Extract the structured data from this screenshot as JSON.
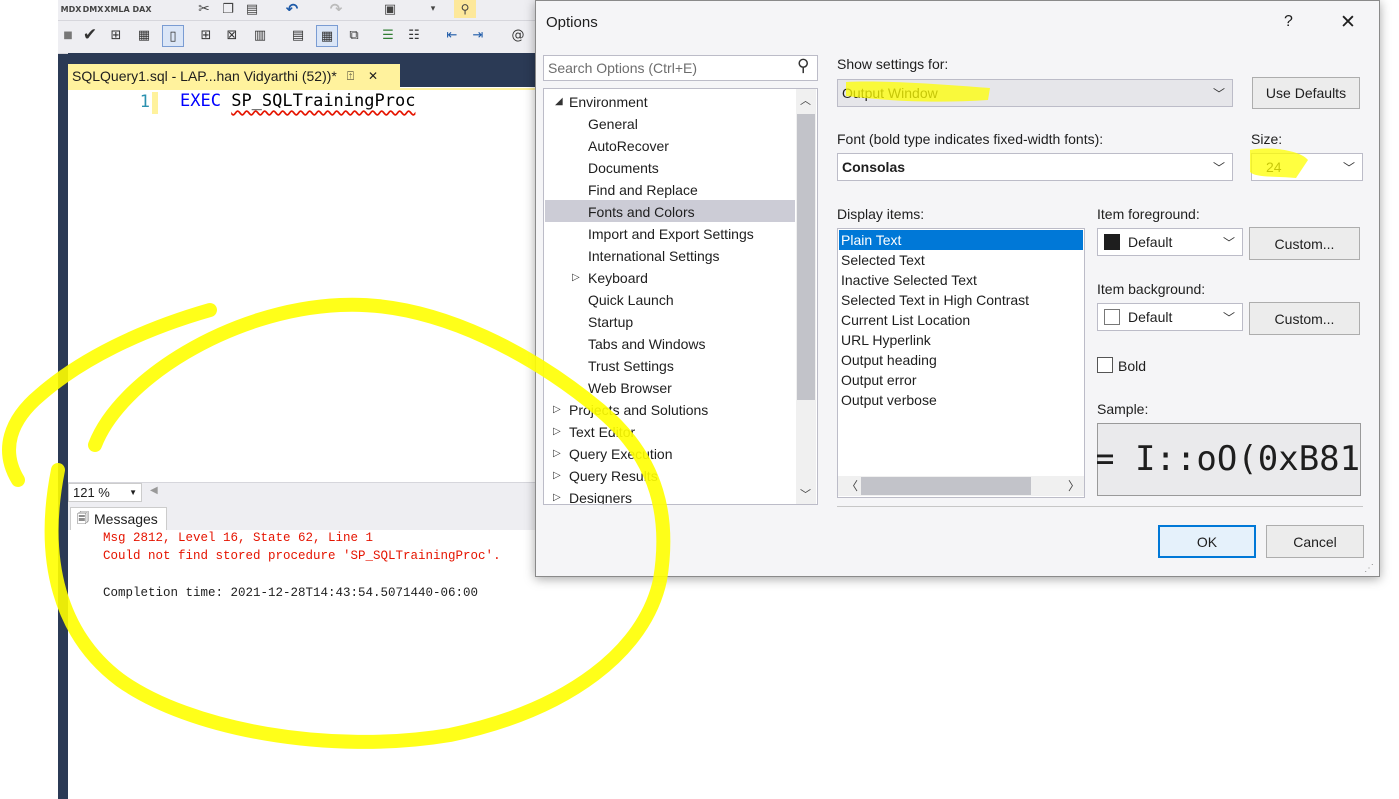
{
  "editor": {
    "tab_title": "SQLQuery1.sql - LAP...han Vidyarthi (52))*",
    "tab_pin": "⍐",
    "tab_close": "✕",
    "line_number": "1",
    "code_keyword": "EXEC",
    "code_identifier": "SP_SQLTrainingProc",
    "zoom": "121 %"
  },
  "results": {
    "tab_label": "Messages",
    "lines": [
      "Msg 2812, Level 16, State 62, Line 1",
      "Could not find stored procedure 'SP_SQLTrainingProc'.",
      "Completion time: 2021-12-28T14:43:54.5071440-06:00"
    ]
  },
  "dialog": {
    "title": "Options",
    "help": "?",
    "close": "✕",
    "search_placeholder": "Search Options (Ctrl+E)",
    "tree": [
      {
        "label": "Environment",
        "level": 0,
        "expanded": true
      },
      {
        "label": "General",
        "level": 1
      },
      {
        "label": "AutoRecover",
        "level": 1
      },
      {
        "label": "Documents",
        "level": 1
      },
      {
        "label": "Find and Replace",
        "level": 1
      },
      {
        "label": "Fonts and Colors",
        "level": 1,
        "selected": true
      },
      {
        "label": "Import and Export Settings",
        "level": 1
      },
      {
        "label": "International Settings",
        "level": 1
      },
      {
        "label": "Keyboard",
        "level": 1,
        "collapsed": true
      },
      {
        "label": "Quick Launch",
        "level": 1
      },
      {
        "label": "Startup",
        "level": 1
      },
      {
        "label": "Tabs and Windows",
        "level": 1
      },
      {
        "label": "Trust Settings",
        "level": 1
      },
      {
        "label": "Web Browser",
        "level": 1
      },
      {
        "label": "Projects and Solutions",
        "level": 0,
        "collapsed": true
      },
      {
        "label": "Text Editor",
        "level": 0,
        "collapsed": true
      },
      {
        "label": "Query Execution",
        "level": 0,
        "collapsed": true
      },
      {
        "label": "Query Results",
        "level": 0,
        "collapsed": true
      },
      {
        "label": "Designers",
        "level": 0,
        "collapsed": true
      }
    ],
    "show_settings_label": "Show settings for:",
    "show_settings_value": "Output Window",
    "use_defaults": "Use Defaults",
    "font_label": "Font (bold type indicates fixed-width fonts):",
    "font_value": "Consolas",
    "size_label": "Size:",
    "size_value": "24",
    "display_items_label": "Display items:",
    "display_items": [
      "Plain Text",
      "Selected Text",
      "Inactive Selected Text",
      "Selected Text in High Contrast",
      "Current List Location",
      "URL Hyperlink",
      "Output heading",
      "Output error",
      "Output verbose"
    ],
    "selected_display_item": "Plain Text",
    "item_foreground_label": "Item foreground:",
    "item_foreground_value": "Default",
    "item_background_label": "Item background:",
    "item_background_value": "Default",
    "custom_label": "Custom...",
    "bold_label": "Bold",
    "sample_label": "Sample:",
    "sample_text": "= I::oO(0xB81",
    "ok": "OK",
    "cancel": "Cancel"
  },
  "colors": {
    "highlight": "#ffff00",
    "selection": "#0078d7",
    "error_text": "#e51400",
    "keyword": "#0000ff",
    "sidebar": "#2b3a55"
  }
}
